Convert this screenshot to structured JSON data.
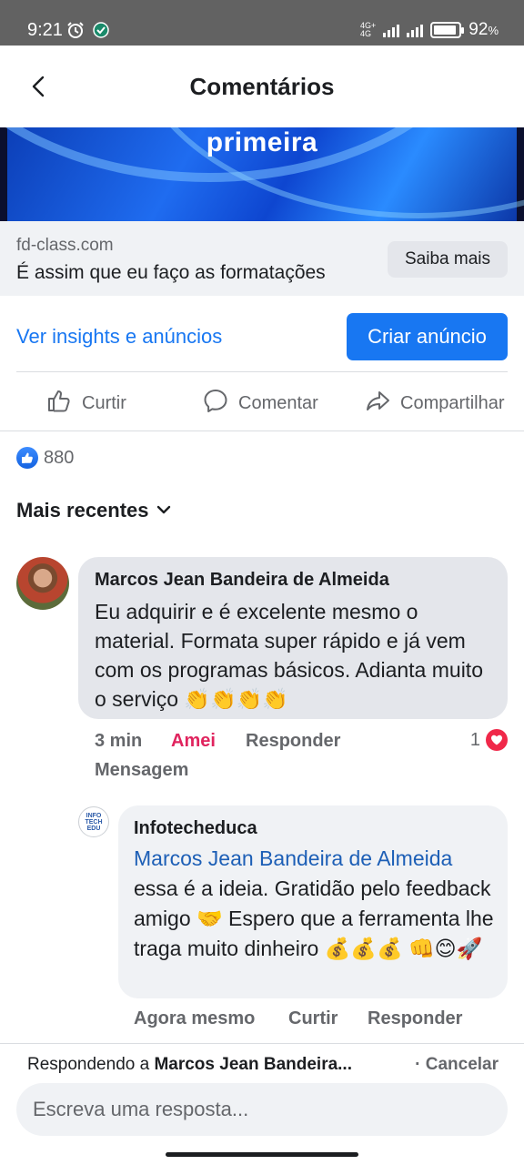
{
  "status_bar": {
    "time": "9:21",
    "network_top": "4G+",
    "network_bottom": "4G",
    "battery": "92",
    "battery_unit": "%",
    "battery_level": 0.92,
    "icons": [
      "alarm-icon",
      "shield-check-icon",
      "signal-icon",
      "battery-icon"
    ]
  },
  "header": {
    "title": "Comentários",
    "back_icon": "chevron-left-icon"
  },
  "ad": {
    "image_caption": "primeira",
    "domain": "fd-class.com",
    "headline": "É assim que eu faço as formatações",
    "cta_label": "Saiba mais"
  },
  "insights": {
    "link_label": "Ver insights e anúncios",
    "create_ad_label": "Criar anúncio"
  },
  "actions": {
    "like": "Curtir",
    "comment": "Comentar",
    "share": "Compartilhar"
  },
  "reactions": {
    "count": "880"
  },
  "sort": {
    "label": "Mais recentes"
  },
  "comments": [
    {
      "author": "Marcos Jean Bandeira de Almeida",
      "text": "Eu adquirir e é excelente mesmo o material. Formata super rápido e já vem com os programas básicos. Adianta muito o serviço 👏👏👏👏",
      "time": "3 min",
      "reaction_label": "Amei",
      "reply_label": "Responder",
      "message_label": "Mensagem",
      "reaction_count": "1"
    }
  ],
  "reply": {
    "author": "Infotecheduca",
    "avatar_text": "INFO TECH EDU",
    "mention": "Marcos Jean Bandeira de Almeida",
    "text": "essa é a ideia. Gratidão pelo feedback amigo 🤝 Espero que a ferramenta lhe traga muito dinheiro 💰💰💰 👊😊🚀",
    "time": "Agora mesmo",
    "like_label": "Curtir",
    "reply_label": "Responder"
  },
  "reply_bar": {
    "replying_prefix": "Respondendo a",
    "replying_to": "Marcos Jean Bandeira...",
    "cancel": "· Cancelar",
    "placeholder": "Escreva uma resposta..."
  },
  "colors": {
    "accent": "#1877f2",
    "love": "#e0245e",
    "status_bar": "#626262"
  }
}
